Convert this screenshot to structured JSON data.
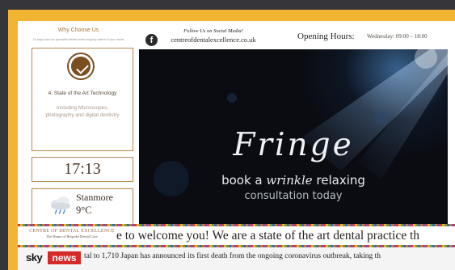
{
  "why": {
    "title": "Why Choose Us",
    "subtitle": "10 ways how our specialist dental centre uniquely caters to your needs",
    "feature_title": "4. State of the Art Technology",
    "feature_desc": "Including Microscopes, photography and digital dentistry"
  },
  "clock": {
    "time": "17:13"
  },
  "weather": {
    "city": "Stanmore",
    "temp": "9°C",
    "icon": "cloud-rain-icon"
  },
  "header": {
    "follow": "Follow Us on Social Media!",
    "site": "centreofdentalexcellence.co.uk",
    "hours_label": "Opening Hours:",
    "hours_value": "Wednesday: 09:00 – 18:00"
  },
  "banner": {
    "title": "Fringe",
    "line1_a": "book a ",
    "line1_b": "wrinkle",
    "line1_c": " relaxing",
    "line2": "consultation today"
  },
  "ticker": {
    "logo_name": "CENTRE OF DENTAL EXCELLENCE",
    "logo_tagline": "The Home of Bespoke Dental Care",
    "welcome_text": "e to welcome you!    We are a state of the art dental practice th"
  },
  "news": {
    "brand_sky": "sky",
    "brand_news": "news",
    "headline": "tal to 1,710  Japan has announced its first death from the ongoing coronavirus outbreak, taking th"
  },
  "colors": {
    "frame": "#f2b433",
    "accent": "#a67a3c",
    "news_red": "#d52a2a"
  }
}
